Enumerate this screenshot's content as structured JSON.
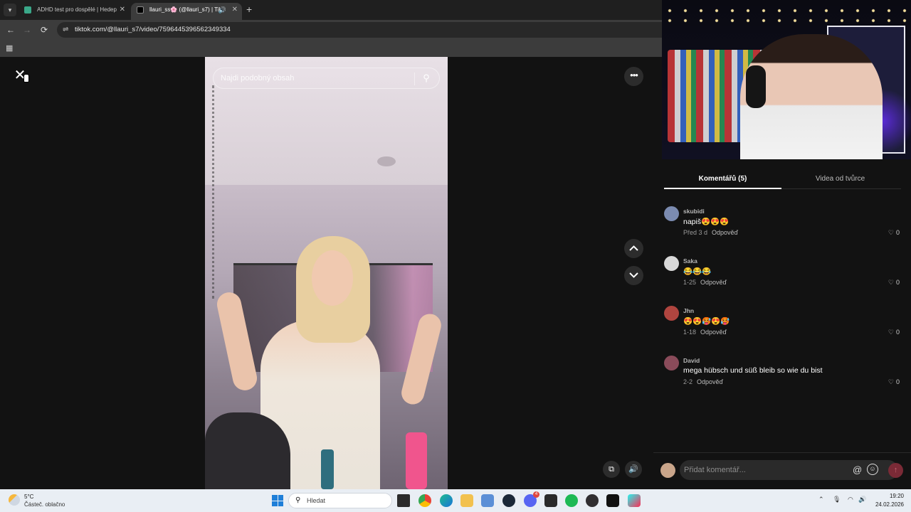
{
  "browser": {
    "tab_list_icon": "chevron-down-icon",
    "tabs": [
      {
        "title": "ADHD test pro dospělé | Hedep",
        "close": "✕",
        "favicon": "hedepy-icon"
      },
      {
        "title": "llauri_ss🌸 (@llauri_s7) | Tik",
        "close": "✕",
        "favicon": "tiktok-icon",
        "audio": "🔊"
      }
    ],
    "new_tab": "+",
    "nav": {
      "back": "←",
      "forward": "→",
      "reload": "⟳"
    },
    "url": "tiktok.com/@llauri_s7/video/7596445396562349334",
    "site_info_icon": "⇌",
    "apps_icon": "▦"
  },
  "player": {
    "close": "✕",
    "search_placeholder": "Najdi podobný obsah",
    "search_icon": "⚲",
    "more": "•••",
    "pip_icon": "⧉",
    "volume_icon": "🔊"
  },
  "right_panel": {
    "tabs": [
      {
        "label": "Komentářů (5)",
        "active": true
      },
      {
        "label": "Videa od tvůrce",
        "active": false
      }
    ],
    "comments": [
      {
        "user": "skubidi",
        "text": "napiš😍😍😍",
        "time": "Před 3 d",
        "reply": "Odpověď",
        "likes": "0"
      },
      {
        "user": "Saka",
        "text": "😂😂😂",
        "time": "1-25",
        "reply": "Odpověď",
        "likes": "0"
      },
      {
        "user": "Jhn",
        "text": "😍😍🥵😍🥵",
        "time": "1-18",
        "reply": "Odpověď",
        "likes": "0"
      },
      {
        "user": "David",
        "text": "mega hübsch und süß bleib so wie du bist",
        "time": "2-2",
        "reply": "Odpověď",
        "likes": "0"
      }
    ],
    "composer": {
      "placeholder": "Přidat komentář...",
      "at": "@",
      "emoji": "☺",
      "post": "↑"
    },
    "heart": "♡"
  },
  "taskbar": {
    "weather_temp": "5°C",
    "weather_desc": "Částeč. oblačno",
    "search_placeholder": "Hledat",
    "search_icon": "⚲",
    "discord_badge": "4",
    "apps": [
      "file-explorer",
      "chrome",
      "edge",
      "folder",
      "notepad",
      "steam",
      "discord",
      "epic-games",
      "spotify",
      "obs",
      "capcut",
      "tiktok"
    ],
    "tray": {
      "chevron": "⌃",
      "mic": "🎙",
      "wifi": "◠",
      "volume": "🔊"
    },
    "time": "19:20",
    "date": "24.02.2026"
  },
  "colors": {
    "tiktok_bg": "#121212",
    "accent_post": "#7a2a36",
    "taskbar": "#e9eef4"
  }
}
